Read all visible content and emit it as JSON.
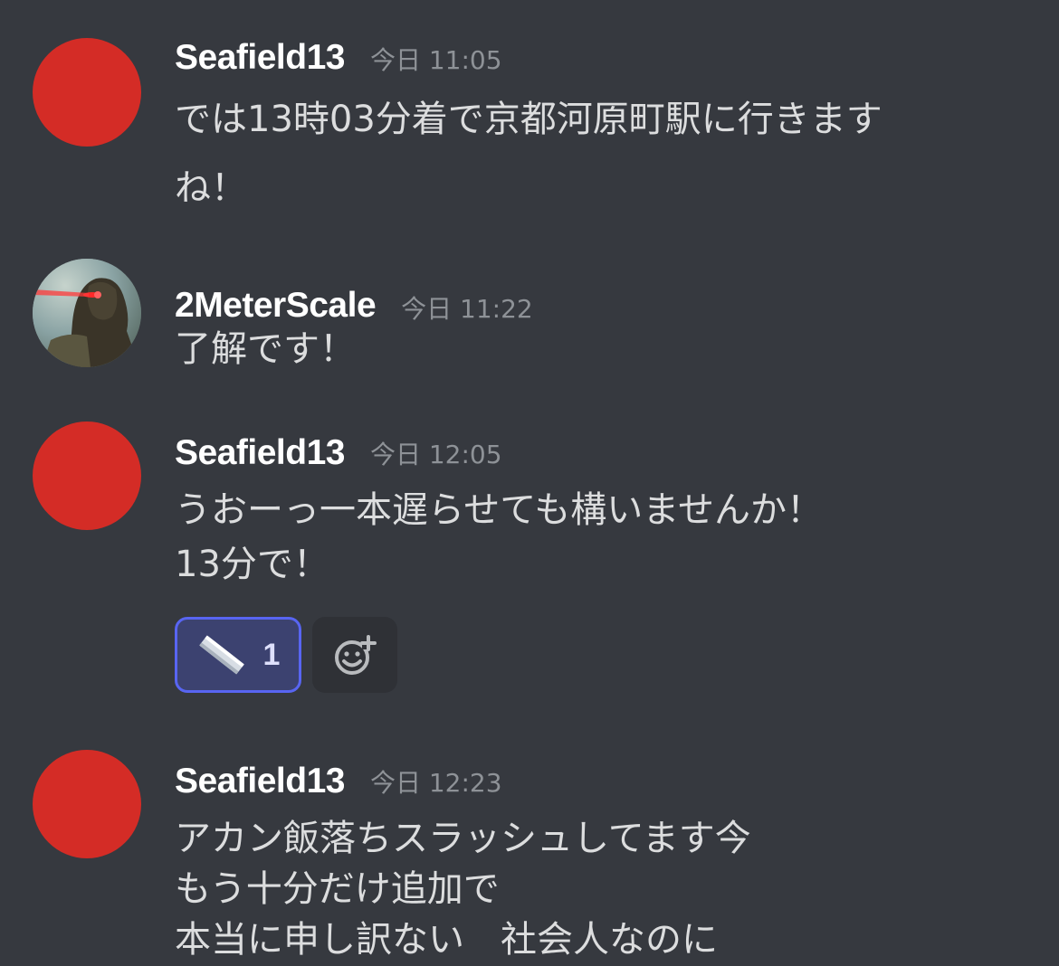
{
  "messages": [
    {
      "username": "Seafield13",
      "timestamp": "今日 11:05",
      "lines": [
        "では13時03分着で京都河原町駅に行きます",
        "ね！"
      ]
    },
    {
      "username": "2MeterScale",
      "timestamp": "今日 11:22",
      "lines": [
        "了解です！"
      ]
    },
    {
      "username": "Seafield13",
      "timestamp": "今日 12:05",
      "lines": [
        "うおーっ一本遅らせても構いませんか！",
        "13分で！"
      ],
      "reactions": [
        {
          "icon": "ruler-icon",
          "count": "1"
        }
      ]
    },
    {
      "username": "Seafield13",
      "timestamp": "今日 12:23",
      "lines": [
        "アカン飯落ちスラッシュしてます今",
        "もう十分だけ追加で",
        "本当に申し訳ない　社会人なのに"
      ]
    }
  ],
  "colors": {
    "background": "#36393f",
    "username": "#ffffff",
    "timestamp": "#8e9297",
    "text": "#dcddde",
    "avatar_red": "#d42c26",
    "reaction_border": "#5865f2",
    "reaction_bg": "#3c4270"
  }
}
